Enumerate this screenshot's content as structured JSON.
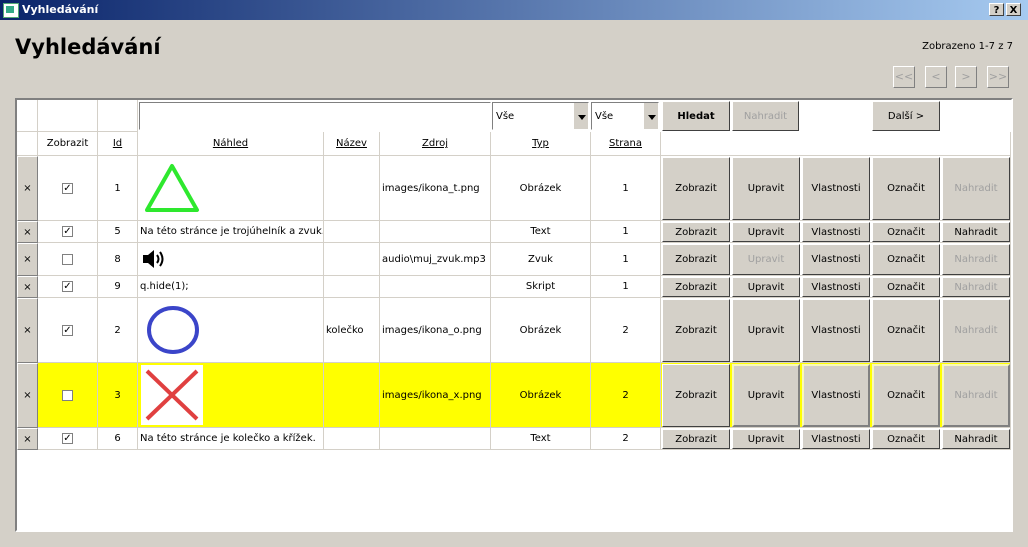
{
  "window": {
    "title": "Vyhledávání",
    "help_btn": "?",
    "close_btn": "X"
  },
  "page_title": "Vyhledávání",
  "counter": "Zobrazeno 1-7 z 7",
  "nav": {
    "first": "<<",
    "prev": "<",
    "next": ">",
    "last": ">>"
  },
  "filter": {
    "search_value": "",
    "source_select": "Vše",
    "type_select": "Vše",
    "search_button": "Hledat",
    "replace_button": "Nahradit",
    "next_button": "Další >"
  },
  "columns": {
    "show": "Zobrazit",
    "id": "Id",
    "preview": "Náhled",
    "name": "Název",
    "source": "Zdroj",
    "type": "Typ",
    "page": "Strana"
  },
  "actions": {
    "view": "Zobrazit",
    "edit": "Upravit",
    "props": "Vlastnosti",
    "mark": "Označit",
    "replace": "Nahradit"
  },
  "rows": [
    {
      "x": "×",
      "checked": true,
      "id": "1",
      "preview_kind": "triangle",
      "preview_text": "",
      "name": "",
      "source": "images/ikona_t.png",
      "type": "Obrázek",
      "page": "1",
      "edit_enabled": true,
      "replace_enabled": false,
      "highlight": false
    },
    {
      "x": "×",
      "checked": true,
      "id": "5",
      "preview_kind": "text",
      "preview_text": "Na této stránce je trojúhelník a zvuk.",
      "name": "",
      "source": "",
      "type": "Text",
      "page": "1",
      "edit_enabled": true,
      "replace_enabled": true,
      "highlight": false
    },
    {
      "x": "×",
      "checked": false,
      "id": "8",
      "preview_kind": "speaker",
      "preview_text": "",
      "name": "",
      "source": "audio\\muj_zvuk.mp3",
      "type": "Zvuk",
      "page": "1",
      "edit_enabled": false,
      "replace_enabled": false,
      "highlight": false
    },
    {
      "x": "×",
      "checked": true,
      "id": "9",
      "preview_kind": "text",
      "preview_text": "q.hide(1);",
      "name": "",
      "source": "",
      "type": "Skript",
      "page": "1",
      "edit_enabled": true,
      "replace_enabled": false,
      "highlight": false
    },
    {
      "x": "×",
      "checked": true,
      "id": "2",
      "preview_kind": "circle",
      "preview_text": "",
      "name": "kolečko",
      "source": "images/ikona_o.png",
      "type": "Obrázek",
      "page": "2",
      "edit_enabled": true,
      "replace_enabled": false,
      "highlight": false
    },
    {
      "x": "×",
      "checked": false,
      "id": "3",
      "preview_kind": "cross",
      "preview_text": "",
      "name": "",
      "source": "images/ikona_x.png",
      "type": "Obrázek",
      "page": "2",
      "edit_enabled": true,
      "replace_enabled": false,
      "highlight": true
    },
    {
      "x": "×",
      "checked": true,
      "id": "6",
      "preview_kind": "text",
      "preview_text": "Na této stránce je kolečko a křížek.",
      "name": "",
      "source": "",
      "type": "Text",
      "page": "2",
      "edit_enabled": true,
      "replace_enabled": true,
      "highlight": false
    }
  ]
}
